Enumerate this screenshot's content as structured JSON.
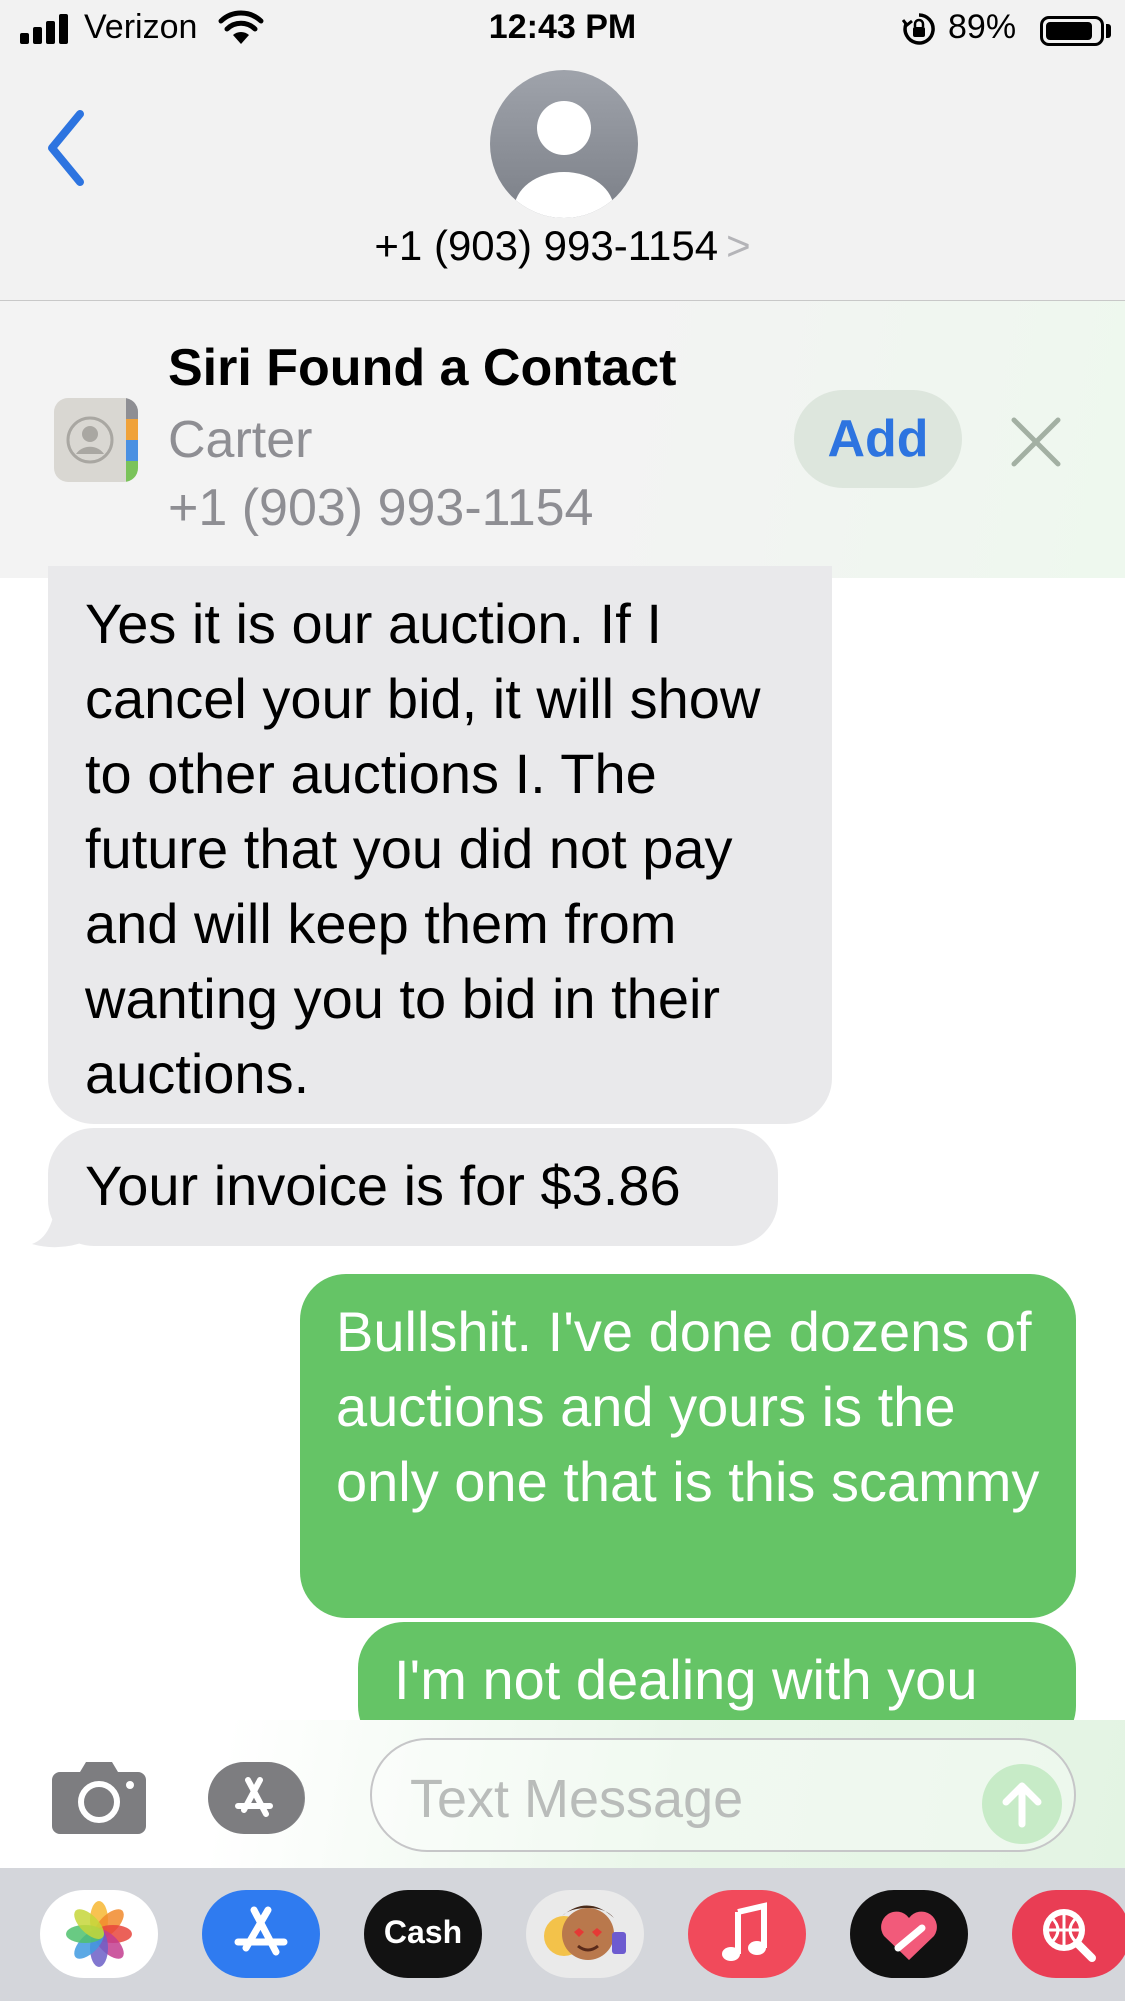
{
  "status_bar": {
    "carrier": "Verizon",
    "time": "12:43 PM",
    "battery_percent": "89%",
    "battery_level": 0.89
  },
  "header": {
    "contact_number": "+1 (903) 993-1154",
    "chevron": ">"
  },
  "siri_suggestion": {
    "title": "Siri Found a Contact",
    "name": "Carter",
    "phone": "+1 (903) 993-1154",
    "add_label": "Add"
  },
  "messages": [
    {
      "direction": "incoming",
      "text": "Yes it is our auction. If I cancel your bid, it will show to other auctions I. The future that you did not pay and will keep them from wanting you to bid in their auctions."
    },
    {
      "direction": "incoming",
      "text": "Your invoice is for $3.86"
    },
    {
      "direction": "outgoing",
      "text": "Bullshit. I've done dozens of auctions and yours is the only one that is this scammy"
    },
    {
      "direction": "outgoing",
      "text": "I'm not dealing with you"
    }
  ],
  "input": {
    "placeholder": "Text Message"
  },
  "app_drawer": {
    "apps": [
      {
        "icon": "photos-icon"
      },
      {
        "icon": "app-store-icon"
      },
      {
        "icon": "apple-cash-icon",
        "label": "Cash"
      },
      {
        "icon": "memoji-icon"
      },
      {
        "icon": "music-icon"
      },
      {
        "icon": "fitness-heart-icon"
      },
      {
        "icon": "web-search-icon"
      }
    ]
  },
  "colors": {
    "accent_blue": "#2d74e0",
    "outgoing_bubble": "#65c466",
    "incoming_bubble": "#e9e9eb"
  }
}
